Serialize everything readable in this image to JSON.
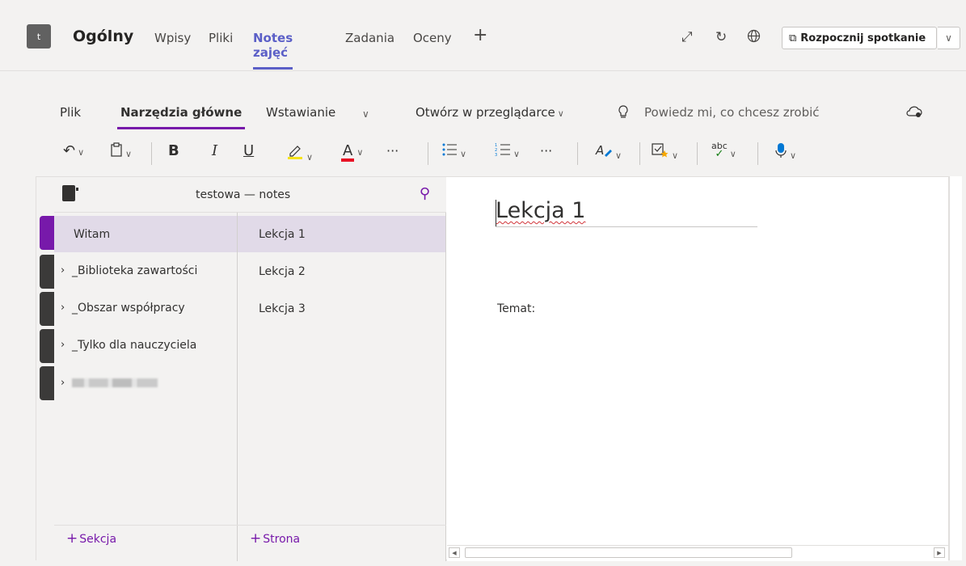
{
  "header": {
    "team_initial": "t",
    "channel": "Ogólny",
    "tabs": [
      "Wpisy",
      "Pliki",
      "Notes zajęć",
      "Zadania",
      "Oceny"
    ],
    "active_tab": "Notes zajęć",
    "add_tab": "+",
    "meet_button": "Rozpocznij spotkanie",
    "accent": "#5b5fc7"
  },
  "ribbon": {
    "tabs": [
      "Plik",
      "Narzędzia główne",
      "Wstawianie",
      "Otwórz w przeglądarce"
    ],
    "active_tab": "Narzędzia główne",
    "tell_me": "Powiedz mi, co chcesz zrobić",
    "bold": "B",
    "italic": "I",
    "underline": "U",
    "font_color": "A",
    "more": "···",
    "spelling": "abc",
    "accent": "#7719aa"
  },
  "notebook": {
    "title": "testowa — notes",
    "sections": [
      {
        "label": "Witam",
        "expandable": false,
        "active": true
      },
      {
        "label": "_Biblioteka zawartości",
        "expandable": true,
        "active": false
      },
      {
        "label": "_Obszar współpracy",
        "expandable": true,
        "active": false
      },
      {
        "label": "_Tylko dla nauczyciela",
        "expandable": true,
        "active": false
      }
    ],
    "pages": [
      {
        "label": "Lekcja 1",
        "active": true
      },
      {
        "label": "Lekcja 2",
        "active": false
      },
      {
        "label": "Lekcja 3",
        "active": false
      }
    ],
    "add_section": "Sekcja",
    "add_page": "Strona",
    "section_color": "#7719aa"
  },
  "page": {
    "title": "Lekcja 1",
    "body": "Temat:"
  }
}
